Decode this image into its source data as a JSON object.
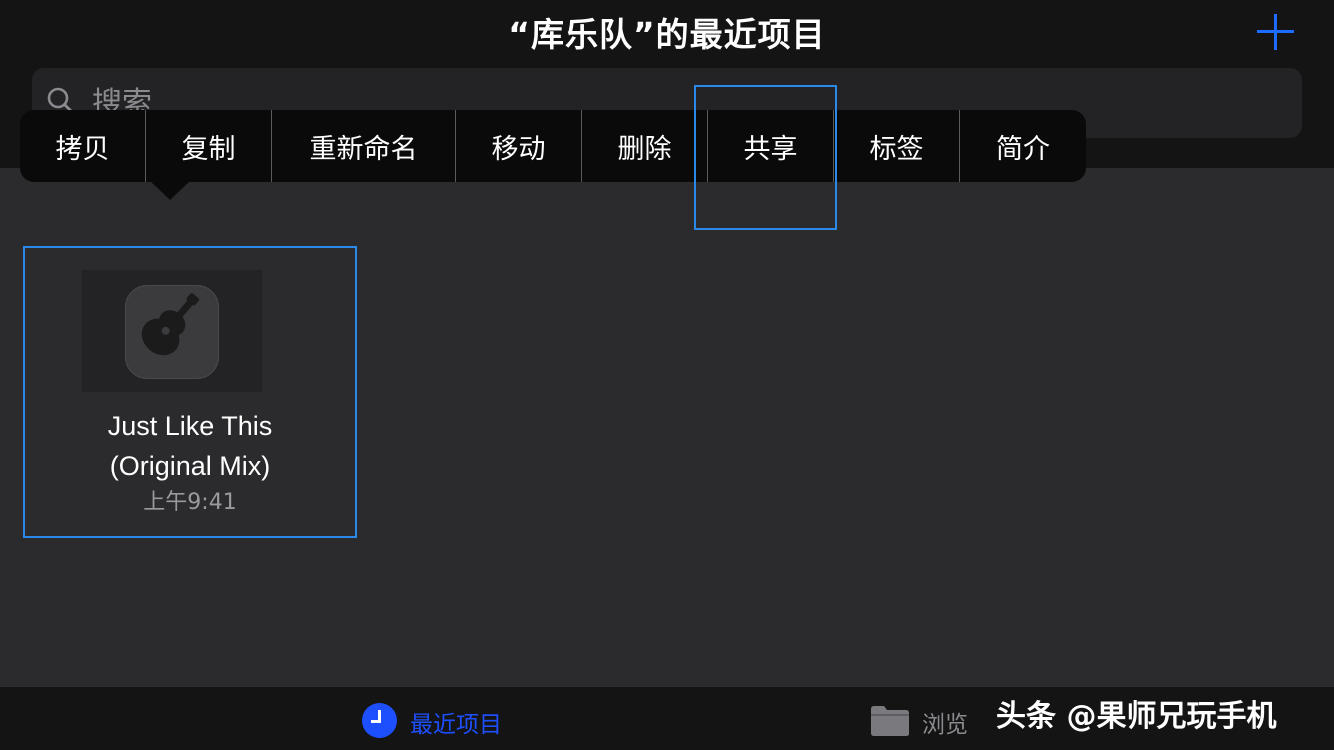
{
  "header": {
    "title": "“库乐队”的最近项目",
    "add_icon": "plus-icon"
  },
  "search": {
    "placeholder": "搜索",
    "icon": "search-icon"
  },
  "context_menu": {
    "items": [
      "拷贝",
      "复制",
      "重新命名",
      "移动",
      "删除",
      "共享",
      "标签",
      "简介"
    ],
    "highlighted": "共享"
  },
  "project": {
    "name_line1": "Just Like This",
    "name_line2": "(Original Mix)",
    "time": "上午9:41",
    "icon": "garageband-guitar-icon"
  },
  "tabbar": {
    "recent_label": "最近项目",
    "browse_label": "浏览",
    "active_color": "#1e4fff"
  },
  "watermark": {
    "text": "头条 @果师兄玩手机"
  }
}
